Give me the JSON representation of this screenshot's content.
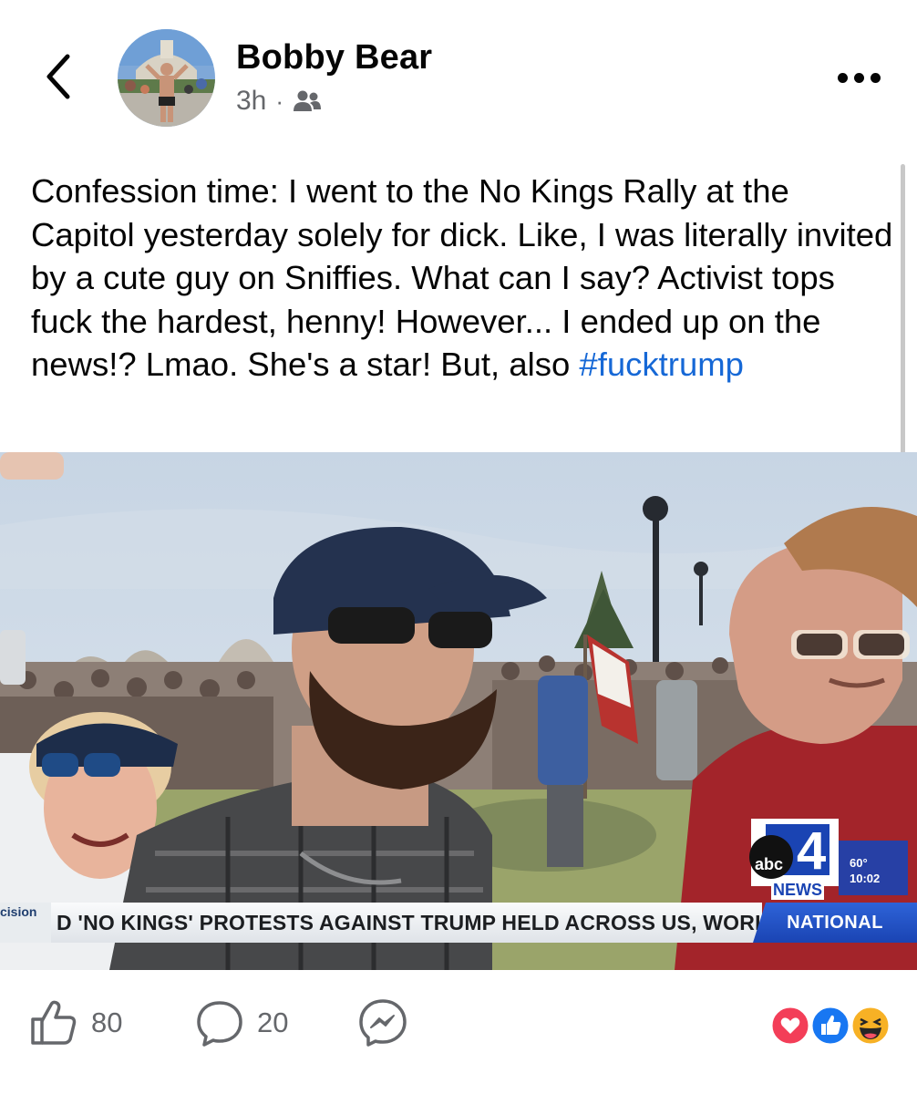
{
  "header": {
    "back_icon": "chevron-left-icon",
    "author_name": "Bobby Bear",
    "time": "3h",
    "separator": "·",
    "audience_icon": "friends-icon",
    "more_icon": "more-horizontal-icon"
  },
  "post": {
    "text": "Confession time: I went to the No Kings Rally at the Capitol yesterday solely for dick. Like, I was literally invited by a cute guy on Sniffies. What can I say? Activist tops fuck the hardest, henny! However... I ended up on the news!? Lmao. She's a star! But, also ",
    "hashtag": "#fucktrump"
  },
  "media": {
    "ticker_left": "cision",
    "headline": "D 'NO KINGS' PROTESTS AGAINST TRUMP HELD ACROSS US, WORLD",
    "section": "NATIONAL",
    "station_abc": "abc",
    "station_number": "4",
    "station_news": "NEWS",
    "temperature": "60°",
    "clock": "10:02"
  },
  "footer": {
    "likes": "80",
    "comments": "20",
    "like_icon": "thumbs-up-icon",
    "comment_icon": "comment-bubble-icon",
    "share_icon": "messenger-icon",
    "reaction_icons": [
      "love-reaction-icon",
      "like-reaction-icon",
      "haha-reaction-icon"
    ]
  },
  "colors": {
    "link": "#1668d6",
    "secondary_text": "#65676b",
    "abc_blue": "#1a44b3",
    "love_red": "#f33e58",
    "like_blue": "#1877f2",
    "haha_yellow": "#f7b125"
  }
}
